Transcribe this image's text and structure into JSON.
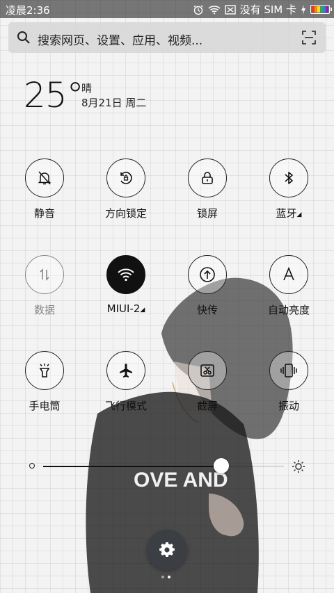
{
  "status_bar": {
    "time": "凌晨2:36",
    "carrier": "没有 SIM 卡",
    "icons": [
      "alarm-icon",
      "wifi-icon",
      "no-sim-icon",
      "charging-icon",
      "battery-icon"
    ]
  },
  "search": {
    "placeholder": "搜索网页、设置、应用、视频...",
    "icons": [
      "search-icon",
      "scan-icon"
    ]
  },
  "weather": {
    "temperature": "25°",
    "condition": "晴",
    "date": "8月21日 周二"
  },
  "toggles": [
    {
      "label": "静音",
      "icon": "mute-bell-icon",
      "state": "off"
    },
    {
      "label": "方向锁定",
      "icon": "rotation-lock-icon",
      "state": "off"
    },
    {
      "label": "锁屏",
      "icon": "lock-icon",
      "state": "off"
    },
    {
      "label": "蓝牙",
      "icon": "bluetooth-icon",
      "state": "off"
    },
    {
      "label": "数据",
      "icon": "mobile-data-icon",
      "state": "disabled"
    },
    {
      "label": "MIUI-2",
      "icon": "wifi-icon",
      "state": "on"
    },
    {
      "label": "快传",
      "icon": "quick-transfer-icon",
      "state": "off"
    },
    {
      "label": "自动亮度",
      "icon": "auto-brightness-icon",
      "state": "off"
    },
    {
      "label": "手电筒",
      "icon": "flashlight-icon",
      "state": "off"
    },
    {
      "label": "飞行模式",
      "icon": "airplane-icon",
      "state": "off"
    },
    {
      "label": "截屏",
      "icon": "screenshot-icon",
      "state": "off"
    },
    {
      "label": "振动",
      "icon": "vibrate-icon",
      "state": "off"
    }
  ],
  "brightness": {
    "level": 0.74
  },
  "settings": {
    "icon": "gear-icon"
  },
  "pager": {
    "pages": 2,
    "current": 1
  },
  "wallpaper": {
    "printed_text": "OVE AND"
  }
}
